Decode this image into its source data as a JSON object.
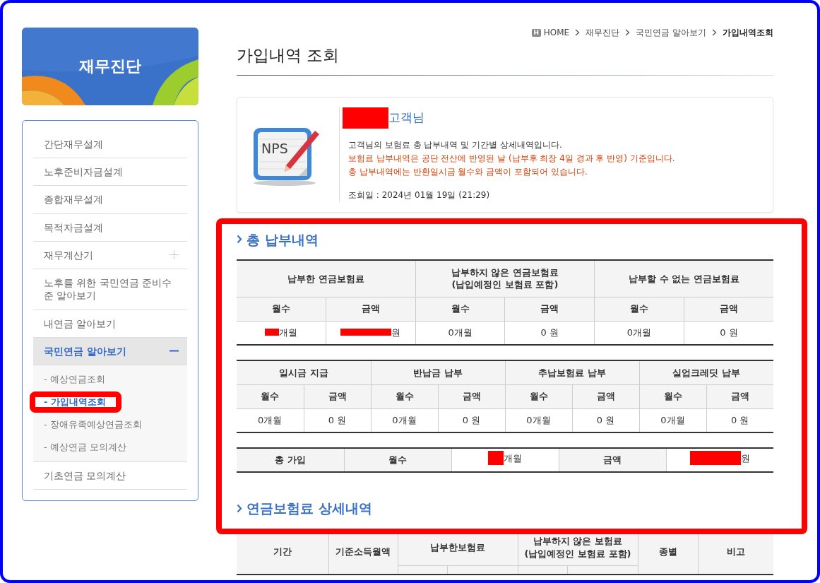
{
  "breadcrumb": {
    "home_icon_letter": "H",
    "items": [
      {
        "label": "HOME",
        "selected": false
      },
      {
        "label": "재무진단",
        "selected": false
      },
      {
        "label": "국민연금 알아보기",
        "selected": false
      },
      {
        "label": "가입내역조회",
        "selected": true
      }
    ]
  },
  "page_title": "가입내역 조회",
  "sidebar": {
    "title": "재무진단",
    "items": [
      {
        "label": "간단재무설계",
        "selected": false
      },
      {
        "label": "노후준비자금설계",
        "selected": false
      },
      {
        "label": "종합재무설계",
        "selected": false
      },
      {
        "label": "목적자금설계",
        "selected": false
      },
      {
        "label": "재무계산기",
        "selected": false,
        "expanded": false
      },
      {
        "label": "노후를 위한 국민연금 준비수준 알아보기",
        "selected": false
      },
      {
        "label": "내연금 알아보기",
        "selected": false
      },
      {
        "label": "국민연금 알아보기",
        "selected": true,
        "expanded": true,
        "children": [
          {
            "label": "- 예상연금조회",
            "selected": false,
            "highlighted": false
          },
          {
            "label": "- 가입내역조회",
            "selected": true,
            "highlighted": true
          },
          {
            "label": "- 장애유족예상연금조회",
            "selected": false,
            "highlighted": false
          },
          {
            "label": "- 예상연금 모의계산",
            "selected": false,
            "highlighted": false
          }
        ]
      },
      {
        "label": "기초연금 모의계산",
        "selected": false
      }
    ]
  },
  "customer": {
    "icon_label": "NPS",
    "name_redacted": true,
    "name_suffix": "고객님",
    "lines": [
      {
        "text": "고객님의 보험료 총 납부내역 및 기간별 상세내역입니다.",
        "kind": "normal"
      },
      {
        "text": "보험료 납부내역은 공단 전산에 반영된 날 (납부후 최장 4일 경과 후 반영) 기준입니다.",
        "kind": "notice"
      },
      {
        "text": "총 납부내역에는 반환일시금 월수와 금액이 포함되어 있습니다.",
        "kind": "notice"
      }
    ],
    "date": "조회일 : 2024년 01월 19일 (21:29)"
  },
  "sections": [
    {
      "title": "총 납부내역",
      "highlighted": true,
      "tables": [
        {
          "kind": "grid",
          "header_rows": [
            [
              {
                "text": "납부한 연금보험료",
                "colspan": 2
              },
              {
                "text": "납부하지 않은 연금보험료\n(납입예정인 보험료 포함)",
                "colspan": 2
              },
              {
                "text": "납부할 수 없는 연금보험료",
                "colspan": 2
              }
            ],
            [
              {
                "text": "월수"
              },
              {
                "text": "금액"
              },
              {
                "text": "월수"
              },
              {
                "text": "금액"
              },
              {
                "text": "월수"
              },
              {
                "text": "금액"
              }
            ]
          ],
          "rows": [
            [
              {
                "text": "개월",
                "redacted": true
              },
              {
                "text": "원",
                "redacted": true
              },
              {
                "text": "0개월"
              },
              {
                "text": "0 원"
              },
              {
                "text": "0개월"
              },
              {
                "text": "0 원"
              }
            ]
          ]
        },
        {
          "kind": "grid",
          "header_rows": [
            [
              {
                "text": "일시금 지급",
                "colspan": 2
              },
              {
                "text": "반납금 납부",
                "colspan": 2
              },
              {
                "text": "추납보험료 납부",
                "colspan": 2
              },
              {
                "text": "실업크레딧 납부",
                "colspan": 2
              }
            ],
            [
              {
                "text": "월수"
              },
              {
                "text": "금액"
              },
              {
                "text": "월수"
              },
              {
                "text": "금액"
              },
              {
                "text": "월수"
              },
              {
                "text": "금액"
              },
              {
                "text": "월수"
              },
              {
                "text": "금액"
              }
            ]
          ],
          "rows": [
            [
              {
                "text": "0개월"
              },
              {
                "text": "0 원"
              },
              {
                "text": "0개월"
              },
              {
                "text": "0 원"
              },
              {
                "text": "0개월"
              },
              {
                "text": "0 원"
              },
              {
                "text": "0개월"
              },
              {
                "text": "0 원"
              }
            ]
          ]
        },
        {
          "kind": "inline",
          "rows": [
            [
              {
                "text": "총 가입",
                "head": true
              },
              {
                "text": "월수",
                "head": true
              },
              {
                "text": "개월",
                "redacted": true
              },
              {
                "text": "금액",
                "head": true
              },
              {
                "text": "원",
                "redacted": true
              }
            ]
          ]
        }
      ]
    },
    {
      "title": "연금보험료 상세내역",
      "tables": [
        {
          "kind": "detail",
          "header_rows": [
            [
              {
                "text": "기간",
                "rowspan": 2
              },
              {
                "text": "기준소득월액",
                "rowspan": 2
              },
              {
                "text": "납부한보험료",
                "colspan": 2
              },
              {
                "text": "납부하지 않은 보험료\n(납입예정인 보험료 포함)",
                "colspan": 2
              },
              {
                "text": "종별",
                "rowspan": 2
              },
              {
                "text": "비고",
                "rowspan": 2
              }
            ],
            [
              {
                "text": ""
              },
              {
                "text": ""
              },
              {
                "text": ""
              },
              {
                "text": ""
              }
            ]
          ]
        }
      ]
    }
  ]
}
